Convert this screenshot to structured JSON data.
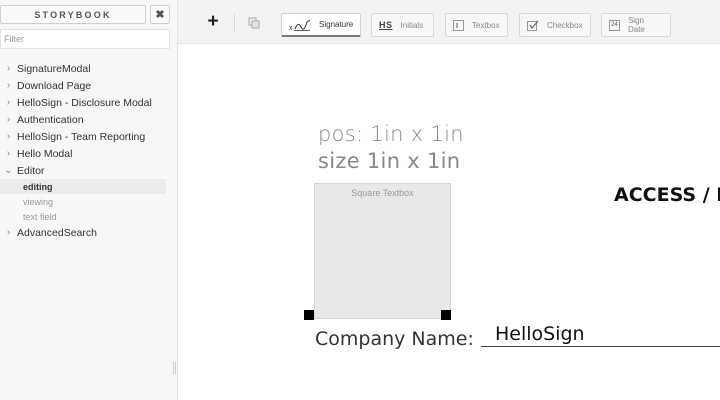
{
  "sidebar": {
    "title": "STORYBOOK",
    "close_icon": "close-icon",
    "filter_placeholder": "Filter",
    "stories": [
      {
        "label": "SignatureModal",
        "expanded": false
      },
      {
        "label": "Download Page",
        "expanded": false
      },
      {
        "label": "HelloSign - Disclosure Modal",
        "expanded": false
      },
      {
        "label": "Authentication",
        "expanded": false
      },
      {
        "label": "HelloSign - Team Reporting",
        "expanded": false
      },
      {
        "label": "Hello Modal",
        "expanded": false
      },
      {
        "label": "Editor",
        "expanded": true,
        "children": [
          {
            "label": "editing",
            "selected": true
          },
          {
            "label": "viewing",
            "selected": false
          },
          {
            "label": "text field",
            "selected": false
          }
        ]
      },
      {
        "label": "AdvancedSearch",
        "expanded": false
      }
    ]
  },
  "toolbar": {
    "add_icon": "plus-icon",
    "copy_icon": "copy-icon",
    "signature_label": "Signature",
    "initials_icon_text": "HS",
    "initials_label": "Initials",
    "textbox_label": "Textbox",
    "checkbox_label": "Checkbox",
    "signdate_icon_text": "24",
    "signdate_label": "Sign Date",
    "active_tool": "Signature"
  },
  "canvas": {
    "pos_readout": "pos: 1in x 1in",
    "size_readout": "size 1in x 1in",
    "field_label": "Square Textbox",
    "heading_partial": "ACCESS / I",
    "company_label": "Company Name:",
    "company_value": "HelloSign"
  },
  "colors": {
    "sidebar_bg": "#f7f7f7",
    "toolbar_bg": "#f2f2f2",
    "field_bg": "#e8e8e8",
    "handle": "#000000"
  }
}
